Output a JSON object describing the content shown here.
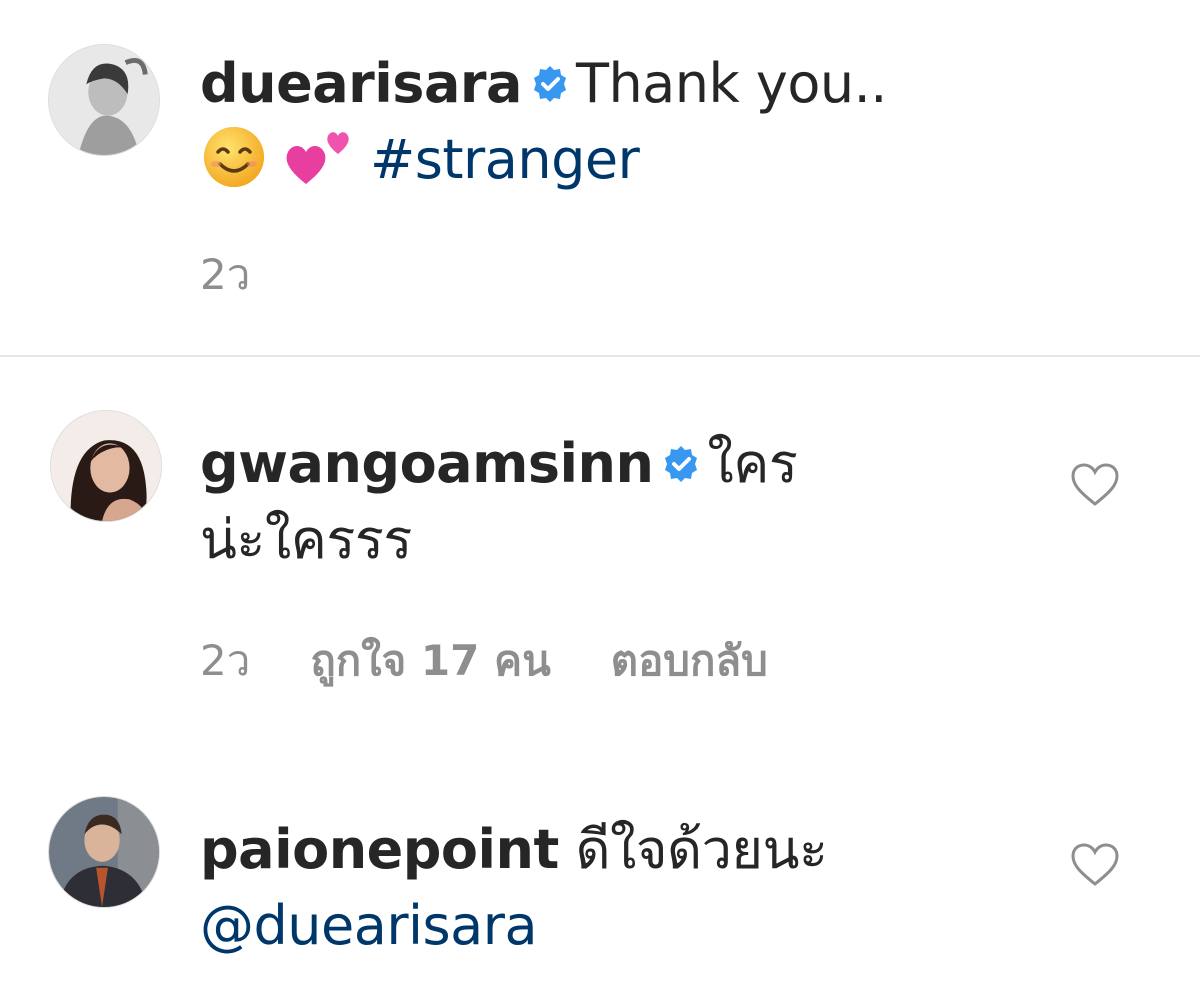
{
  "comments": [
    {
      "username": "duearisara",
      "verified": true,
      "text": "Thank you..",
      "emojis": [
        "smiling-face-emoji",
        "two-hearts-emoji"
      ],
      "hashtag": "#stranger",
      "time": "2ว"
    },
    {
      "username": "gwangoamsinn",
      "verified": true,
      "text_line1": "ใคร",
      "text_line2": "น่ะใครรร",
      "time": "2ว",
      "likes": "ถูกใจ 17 คน",
      "reply": "ตอบกลับ"
    },
    {
      "username": "paionepoint",
      "verified": false,
      "text": "ดีใจด้วยนะ",
      "mention": "@duearisara"
    }
  ],
  "colors": {
    "text": "#262626",
    "muted": "#8e8e8e",
    "link": "#00376b",
    "verified": "#3897f0",
    "divider": "#e6e6e6"
  }
}
